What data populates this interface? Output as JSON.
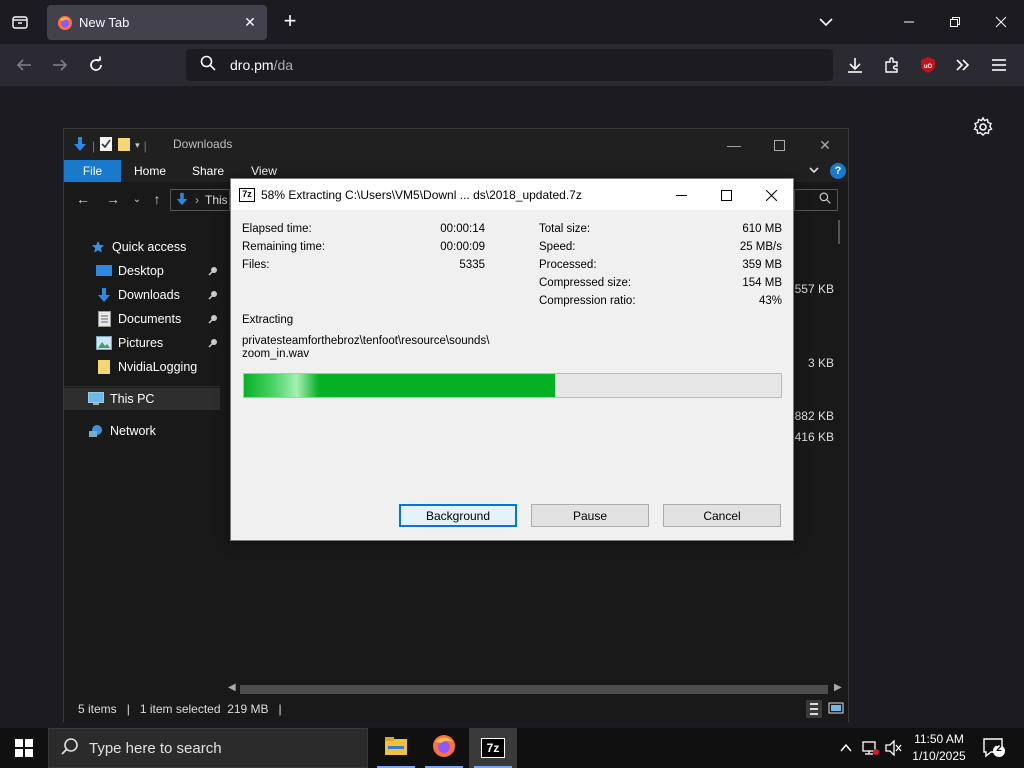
{
  "browser": {
    "tab_title": "New Tab",
    "url_host": "dro.pm",
    "url_path": "/da"
  },
  "explorer": {
    "title": "Downloads",
    "ribbon": {
      "file": "File",
      "home": "Home",
      "share": "Share",
      "view": "View"
    },
    "path_partial": "This",
    "nav": {
      "quick_access": "Quick access",
      "desktop": "Desktop",
      "downloads": "Downloads",
      "documents": "Documents",
      "pictures": "Pictures",
      "nvidia": "NvidiaLogging",
      "this_pc": "This PC",
      "network": "Network"
    },
    "sizes": [
      "557 KB",
      "3 KB",
      "882 KB",
      "416 KB"
    ],
    "status": {
      "items": "5 items",
      "selected": "1 item selected  219 MB"
    }
  },
  "dialog": {
    "title": "58% Extracting C:\\Users\\VM5\\Downl ... ds\\2018_updated.7z",
    "icon_text": "7z",
    "left": {
      "elapsed_label": "Elapsed time:",
      "elapsed_value": "00:00:14",
      "remaining_label": "Remaining time:",
      "remaining_value": "00:00:09",
      "files_label": "Files:",
      "files_value": "5335"
    },
    "right": {
      "total_label": "Total size:",
      "total_value": "610 MB",
      "speed_label": "Speed:",
      "speed_value": "25 MB/s",
      "processed_label": "Processed:",
      "processed_value": "359 MB",
      "compressed_label": "Compressed size:",
      "compressed_value": "154 MB",
      "ratio_label": "Compression ratio:",
      "ratio_value": "43%"
    },
    "extracting_label": "Extracting",
    "current_file_line1": "privatesteamforthebroz\\tenfoot\\resource\\sounds\\",
    "current_file_line2": "zoom_in.wav",
    "progress_fraction": 0.58,
    "buttons": {
      "background": "Background",
      "pause": "Pause",
      "cancel": "Cancel"
    }
  },
  "taskbar": {
    "search_placeholder": "Type here to search",
    "time": "11:50 AM",
    "date": "1/10/2025",
    "notifications": "2",
    "sevenzip_label": "7z"
  },
  "colors": {
    "accent_blue": "#1979ca",
    "progress_green": "#06b025",
    "dialog_bg": "#f0f0f0"
  },
  "icons": [
    "tab-list-icon",
    "firefox-icon",
    "close-icon",
    "plus-icon",
    "chevron-down-icon",
    "minimize-icon",
    "restore-icon",
    "back-icon",
    "forward-icon",
    "reload-icon",
    "search-icon",
    "download-icon",
    "extensions-icon",
    "ublock-icon",
    "overflow-icon",
    "menu-icon",
    "gear-icon",
    "folder-icon",
    "windows-logo-icon",
    "network-icon",
    "speaker-muted-icon",
    "notification-icon"
  ]
}
